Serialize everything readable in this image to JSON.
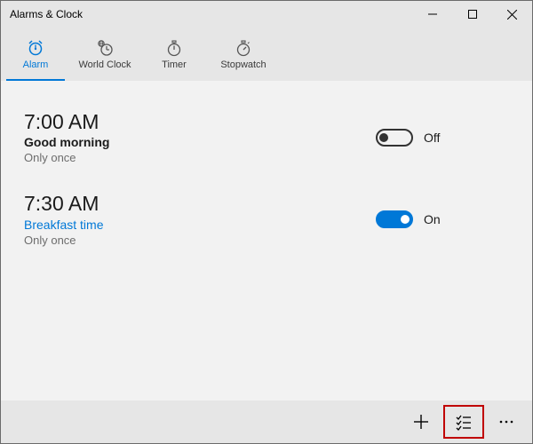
{
  "window": {
    "title": "Alarms & Clock"
  },
  "tabs": [
    {
      "label": "Alarm",
      "icon": "alarm-icon",
      "active": true
    },
    {
      "label": "World Clock",
      "icon": "world-clock-icon",
      "active": false
    },
    {
      "label": "Timer",
      "icon": "timer-icon",
      "active": false
    },
    {
      "label": "Stopwatch",
      "icon": "stopwatch-icon",
      "active": false
    }
  ],
  "alarms": [
    {
      "time": "7:00 AM",
      "name": "Good morning",
      "repeat": "Only once",
      "enabled": false,
      "state_label": "Off"
    },
    {
      "time": "7:30 AM",
      "name": "Breakfast time",
      "repeat": "Only once",
      "enabled": true,
      "state_label": "On"
    }
  ],
  "commandbar": {
    "add": "add-button",
    "select": "select-button",
    "more": "more-button",
    "highlighted": "select-button"
  },
  "colors": {
    "accent": "#0078d7",
    "chrome": "#e6e6e6",
    "content_bg": "#f2f2f2",
    "highlight_box": "#c00000"
  }
}
